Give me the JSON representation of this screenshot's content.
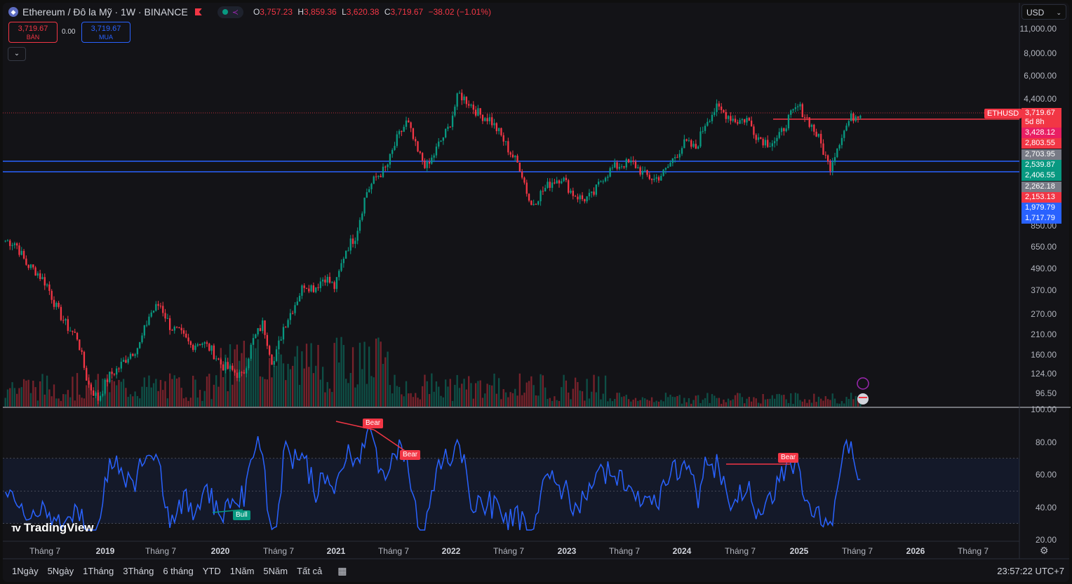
{
  "legend": {
    "symbol": "Ethereum / Đô la Mỹ · 1W · BINANCE",
    "open_label": "O",
    "open": "3,757.23",
    "high_label": "H",
    "high": "3,859.36",
    "low_label": "L",
    "low": "3,620.38",
    "close_label": "C",
    "close": "3,719.67",
    "change": "−38.02 (−1.01%)"
  },
  "trade": {
    "sell_price": "3,719.67",
    "sell_label": "BÁN",
    "buy_price": "3,719.67",
    "buy_label": "MUA",
    "spread": "0.00"
  },
  "currency": "USD",
  "price_axis": [
    "11,000.00",
    "8,000.00",
    "6,000.00",
    "4,400.00",
    "850.00",
    "650.00",
    "490.00",
    "370.00",
    "270.00",
    "210.00",
    "160.00",
    "124.00",
    "96.50"
  ],
  "rsi_axis": [
    "100.00",
    "80.00",
    "60.00",
    "40.00",
    "20.00"
  ],
  "price_tags": {
    "ethusd_label": "ETHUSD",
    "current": "3,719.67",
    "countdown": "5d 8h",
    "levels": [
      "3,428.12",
      "2,803.55",
      "2,703.95",
      "2,539.87",
      "2,406.55",
      "2,262.18",
      "2,153.13",
      "1,979.79",
      "1,717.79"
    ]
  },
  "colors": {
    "up": "#089981",
    "down": "#f23645",
    "rsi": "#2962ff",
    "accent": "#2962ff"
  },
  "divergence_tags": [
    "Bear",
    "Bear",
    "Bull",
    "Bear"
  ],
  "x_axis": [
    "Tháng 7",
    "2019",
    "Tháng 7",
    "2020",
    "Tháng 7",
    "2021",
    "Tháng 7",
    "2022",
    "Tháng 7",
    "2023",
    "Tháng 7",
    "2024",
    "Tháng 7",
    "2025",
    "Tháng 7",
    "2026",
    "Tháng 7"
  ],
  "ranges": [
    "1Ngày",
    "5Ngày",
    "1Tháng",
    "3Tháng",
    "6 tháng",
    "YTD",
    "1Năm",
    "5Năm",
    "Tất cả"
  ],
  "clock": "23:57:22 UTC+7",
  "watermark": "TradingView",
  "chart_data": {
    "type": "candlestick",
    "interval": "1W",
    "scale": "log",
    "x_start": "2018-05",
    "x_end": "2025-07",
    "close": [
      700,
      680,
      520,
      470,
      400,
      290,
      230,
      200,
      110,
      90,
      120,
      135,
      160,
      180,
      270,
      310,
      230,
      210,
      180,
      190,
      170,
      140,
      130,
      120,
      190,
      240,
      140,
      230,
      300,
      400,
      380,
      440,
      380,
      620,
      750,
      1300,
      1600,
      1800,
      2600,
      3300,
      2200,
      1800,
      2400,
      3000,
      4700,
      4200,
      3600,
      3400,
      2800,
      2200,
      1800,
      1100,
      1300,
      1500,
      1600,
      1300,
      1200,
      1250,
      1600,
      1800,
      1900,
      1900,
      1650,
      1550,
      1700,
      2100,
      2500,
      2300,
      3300,
      3900,
      3600,
      3300,
      3400,
      2700,
      2500,
      2600,
      3400,
      4000,
      3300,
      2600,
      1800,
      2600,
      3400,
      3720
    ],
    "horizontal_lines": [
      2539.87,
      2406.55
    ],
    "resistance_line": 3719.67,
    "rsi": {
      "levels": [
        70,
        50,
        30
      ],
      "range": [
        20,
        100
      ]
    }
  }
}
